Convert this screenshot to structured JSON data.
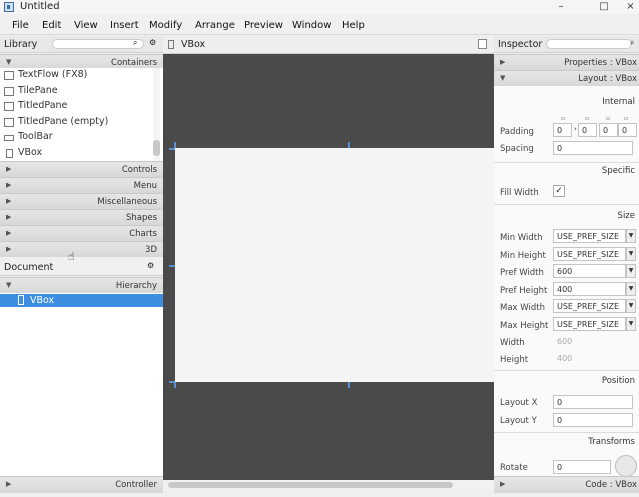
{
  "window": {
    "title": "Untitled",
    "minimize": "–",
    "maximize": "□",
    "close": "×"
  },
  "menu": [
    "File",
    "Edit",
    "View",
    "Insert",
    "Modify",
    "Arrange",
    "Preview",
    "Window",
    "Help"
  ],
  "library": {
    "title": "Library",
    "sections_top": {
      "label": "Containers"
    },
    "items": [
      "TextFlow  (FX8)",
      "TilePane",
      "TitledPane",
      "TitledPane  (empty)",
      "ToolBar",
      "VBox"
    ],
    "sections": [
      "Controls",
      "Menu",
      "Miscellaneous",
      "Shapes",
      "Charts",
      "3D"
    ]
  },
  "document": {
    "title": "Document",
    "hierarchy_label": "Hierarchy",
    "tree_item": "VBox",
    "controller_label": "Controller"
  },
  "canvas": {
    "breadcrumb": "VBox"
  },
  "inspector": {
    "title": "Inspector",
    "properties_label": "Properties : VBox",
    "layout_label": "Layout : VBox",
    "code_label": "Code : VBox",
    "internal": "Internal",
    "padding_label": "Padding",
    "padding": [
      "0",
      "0",
      "0",
      "0"
    ],
    "spacing_label": "Spacing",
    "spacing": "0",
    "specific": "Specific",
    "fill_width_label": "Fill Width",
    "fill_width_checked": "✓",
    "size": "Size",
    "min_width_label": "Min Width",
    "min_width": "USE_PREF_SIZE",
    "min_height_label": "Min Height",
    "min_height": "USE_PREF_SIZE",
    "pref_width_label": "Pref Width",
    "pref_width": "600",
    "pref_height_label": "Pref Height",
    "pref_height": "400",
    "max_width_label": "Max Width",
    "max_width": "USE_PREF_SIZE",
    "max_height_label": "Max Height",
    "max_height": "USE_PREF_SIZE",
    "width_label": "Width",
    "width": "600",
    "height_label": "Height",
    "height": "400",
    "position": "Position",
    "layout_x_label": "Layout X",
    "layout_x": "0",
    "layout_y_label": "Layout Y",
    "layout_y": "0",
    "transforms": "Transforms",
    "rotate_label": "Rotate",
    "rotate": "0"
  },
  "colors": {
    "selection": "#3d8ee0",
    "canvas": "#4a4a4a",
    "handle": "#5a8ed6"
  }
}
